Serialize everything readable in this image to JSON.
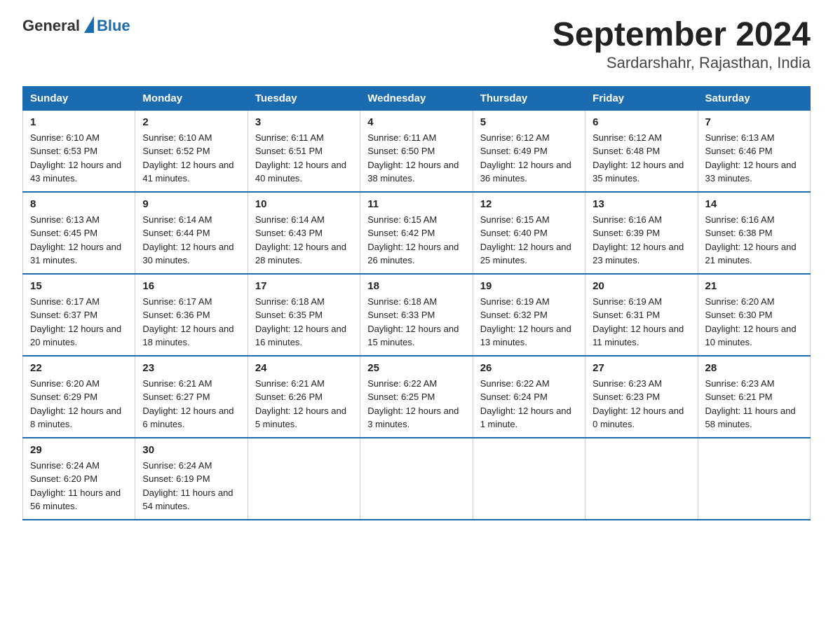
{
  "logo": {
    "general": "General",
    "blue": "Blue"
  },
  "title": "September 2024",
  "subtitle": "Sardarshahr, Rajasthan, India",
  "days_of_week": [
    "Sunday",
    "Monday",
    "Tuesday",
    "Wednesday",
    "Thursday",
    "Friday",
    "Saturday"
  ],
  "weeks": [
    [
      {
        "day": "1",
        "sunrise": "6:10 AM",
        "sunset": "6:53 PM",
        "daylight": "12 hours and 43 minutes."
      },
      {
        "day": "2",
        "sunrise": "6:10 AM",
        "sunset": "6:52 PM",
        "daylight": "12 hours and 41 minutes."
      },
      {
        "day": "3",
        "sunrise": "6:11 AM",
        "sunset": "6:51 PM",
        "daylight": "12 hours and 40 minutes."
      },
      {
        "day": "4",
        "sunrise": "6:11 AM",
        "sunset": "6:50 PM",
        "daylight": "12 hours and 38 minutes."
      },
      {
        "day": "5",
        "sunrise": "6:12 AM",
        "sunset": "6:49 PM",
        "daylight": "12 hours and 36 minutes."
      },
      {
        "day": "6",
        "sunrise": "6:12 AM",
        "sunset": "6:48 PM",
        "daylight": "12 hours and 35 minutes."
      },
      {
        "day": "7",
        "sunrise": "6:13 AM",
        "sunset": "6:46 PM",
        "daylight": "12 hours and 33 minutes."
      }
    ],
    [
      {
        "day": "8",
        "sunrise": "6:13 AM",
        "sunset": "6:45 PM",
        "daylight": "12 hours and 31 minutes."
      },
      {
        "day": "9",
        "sunrise": "6:14 AM",
        "sunset": "6:44 PM",
        "daylight": "12 hours and 30 minutes."
      },
      {
        "day": "10",
        "sunrise": "6:14 AM",
        "sunset": "6:43 PM",
        "daylight": "12 hours and 28 minutes."
      },
      {
        "day": "11",
        "sunrise": "6:15 AM",
        "sunset": "6:42 PM",
        "daylight": "12 hours and 26 minutes."
      },
      {
        "day": "12",
        "sunrise": "6:15 AM",
        "sunset": "6:40 PM",
        "daylight": "12 hours and 25 minutes."
      },
      {
        "day": "13",
        "sunrise": "6:16 AM",
        "sunset": "6:39 PM",
        "daylight": "12 hours and 23 minutes."
      },
      {
        "day": "14",
        "sunrise": "6:16 AM",
        "sunset": "6:38 PM",
        "daylight": "12 hours and 21 minutes."
      }
    ],
    [
      {
        "day": "15",
        "sunrise": "6:17 AM",
        "sunset": "6:37 PM",
        "daylight": "12 hours and 20 minutes."
      },
      {
        "day": "16",
        "sunrise": "6:17 AM",
        "sunset": "6:36 PM",
        "daylight": "12 hours and 18 minutes."
      },
      {
        "day": "17",
        "sunrise": "6:18 AM",
        "sunset": "6:35 PM",
        "daylight": "12 hours and 16 minutes."
      },
      {
        "day": "18",
        "sunrise": "6:18 AM",
        "sunset": "6:33 PM",
        "daylight": "12 hours and 15 minutes."
      },
      {
        "day": "19",
        "sunrise": "6:19 AM",
        "sunset": "6:32 PM",
        "daylight": "12 hours and 13 minutes."
      },
      {
        "day": "20",
        "sunrise": "6:19 AM",
        "sunset": "6:31 PM",
        "daylight": "12 hours and 11 minutes."
      },
      {
        "day": "21",
        "sunrise": "6:20 AM",
        "sunset": "6:30 PM",
        "daylight": "12 hours and 10 minutes."
      }
    ],
    [
      {
        "day": "22",
        "sunrise": "6:20 AM",
        "sunset": "6:29 PM",
        "daylight": "12 hours and 8 minutes."
      },
      {
        "day": "23",
        "sunrise": "6:21 AM",
        "sunset": "6:27 PM",
        "daylight": "12 hours and 6 minutes."
      },
      {
        "day": "24",
        "sunrise": "6:21 AM",
        "sunset": "6:26 PM",
        "daylight": "12 hours and 5 minutes."
      },
      {
        "day": "25",
        "sunrise": "6:22 AM",
        "sunset": "6:25 PM",
        "daylight": "12 hours and 3 minutes."
      },
      {
        "day": "26",
        "sunrise": "6:22 AM",
        "sunset": "6:24 PM",
        "daylight": "12 hours and 1 minute."
      },
      {
        "day": "27",
        "sunrise": "6:23 AM",
        "sunset": "6:23 PM",
        "daylight": "12 hours and 0 minutes."
      },
      {
        "day": "28",
        "sunrise": "6:23 AM",
        "sunset": "6:21 PM",
        "daylight": "11 hours and 58 minutes."
      }
    ],
    [
      {
        "day": "29",
        "sunrise": "6:24 AM",
        "sunset": "6:20 PM",
        "daylight": "11 hours and 56 minutes."
      },
      {
        "day": "30",
        "sunrise": "6:24 AM",
        "sunset": "6:19 PM",
        "daylight": "11 hours and 54 minutes."
      },
      null,
      null,
      null,
      null,
      null
    ]
  ],
  "labels": {
    "sunrise_prefix": "Sunrise: ",
    "sunset_prefix": "Sunset: ",
    "daylight_prefix": "Daylight: "
  }
}
